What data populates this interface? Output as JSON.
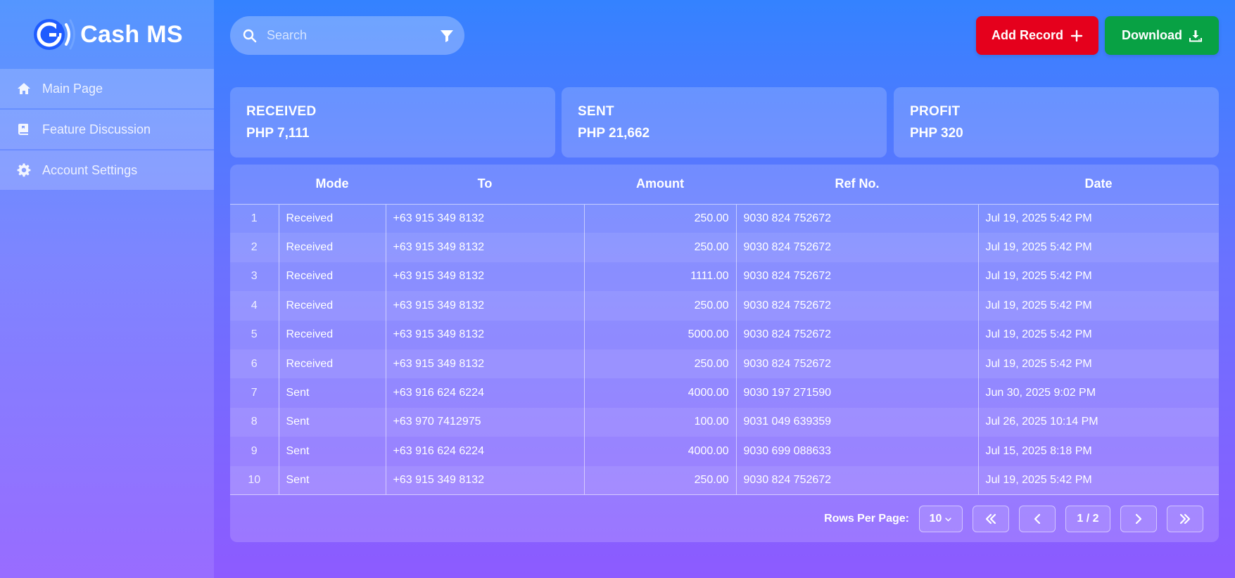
{
  "app": {
    "name": "Cash MS"
  },
  "sidebar": {
    "items": [
      {
        "label": "Main Page",
        "icon": "home-icon"
      },
      {
        "label": "Feature Discussion",
        "icon": "book-icon"
      },
      {
        "label": "Account Settings",
        "icon": "gear-icon"
      }
    ]
  },
  "search": {
    "placeholder": "Search",
    "value": ""
  },
  "toolbar": {
    "add_label": "Add Record",
    "download_label": "Download"
  },
  "summary": [
    {
      "title": "RECEIVED",
      "value": "PHP 7,111"
    },
    {
      "title": "SENT",
      "value": "PHP 21,662"
    },
    {
      "title": "PROFIT",
      "value": "PHP 320"
    }
  ],
  "table": {
    "headers": [
      "",
      "Mode",
      "To",
      "Amount",
      "Ref No.",
      "Date"
    ],
    "rows": [
      {
        "n": "1",
        "mode": "Received",
        "to": "+63 915 349 8132",
        "amount": "250.00",
        "ref": "9030 824 752672",
        "date": "Jul 19, 2025 5:42 PM"
      },
      {
        "n": "2",
        "mode": "Received",
        "to": "+63 915 349 8132",
        "amount": "250.00",
        "ref": "9030 824 752672",
        "date": "Jul 19, 2025 5:42 PM"
      },
      {
        "n": "3",
        "mode": "Received",
        "to": "+63 915 349 8132",
        "amount": "1111.00",
        "ref": "9030 824 752672",
        "date": "Jul 19, 2025 5:42 PM"
      },
      {
        "n": "4",
        "mode": "Received",
        "to": "+63 915 349 8132",
        "amount": "250.00",
        "ref": "9030 824 752672",
        "date": "Jul 19, 2025 5:42 PM"
      },
      {
        "n": "5",
        "mode": "Received",
        "to": "+63 915 349 8132",
        "amount": "5000.00",
        "ref": "9030 824 752672",
        "date": "Jul 19, 2025 5:42 PM"
      },
      {
        "n": "6",
        "mode": "Received",
        "to": "+63 915 349 8132",
        "amount": "250.00",
        "ref": "9030 824 752672",
        "date": "Jul 19, 2025 5:42 PM"
      },
      {
        "n": "7",
        "mode": "Sent",
        "to": "+63 916 624 6224",
        "amount": "4000.00",
        "ref": "9030 197 271590",
        "date": "Jun 30, 2025 9:02 PM"
      },
      {
        "n": "8",
        "mode": "Sent",
        "to": "+63 970 7412975",
        "amount": "100.00",
        "ref": "9031 049 639359",
        "date": "Jul 26, 2025 10:14 PM"
      },
      {
        "n": "9",
        "mode": "Sent",
        "to": "+63 916 624 6224",
        "amount": "4000.00",
        "ref": "9030 699 088633",
        "date": "Jul 15, 2025 8:18 PM"
      },
      {
        "n": "10",
        "mode": "Sent",
        "to": "+63 915 349 8132",
        "amount": "250.00",
        "ref": "9030 824 752672",
        "date": "Jul 19, 2025 5:42 PM"
      }
    ]
  },
  "pager": {
    "label": "Rows Per Page:",
    "rows_per_page": "10",
    "page": "1 / 2"
  },
  "colors": {
    "add": "#e5001c",
    "download": "#08a144",
    "logo_blue": "#1f5cff"
  }
}
